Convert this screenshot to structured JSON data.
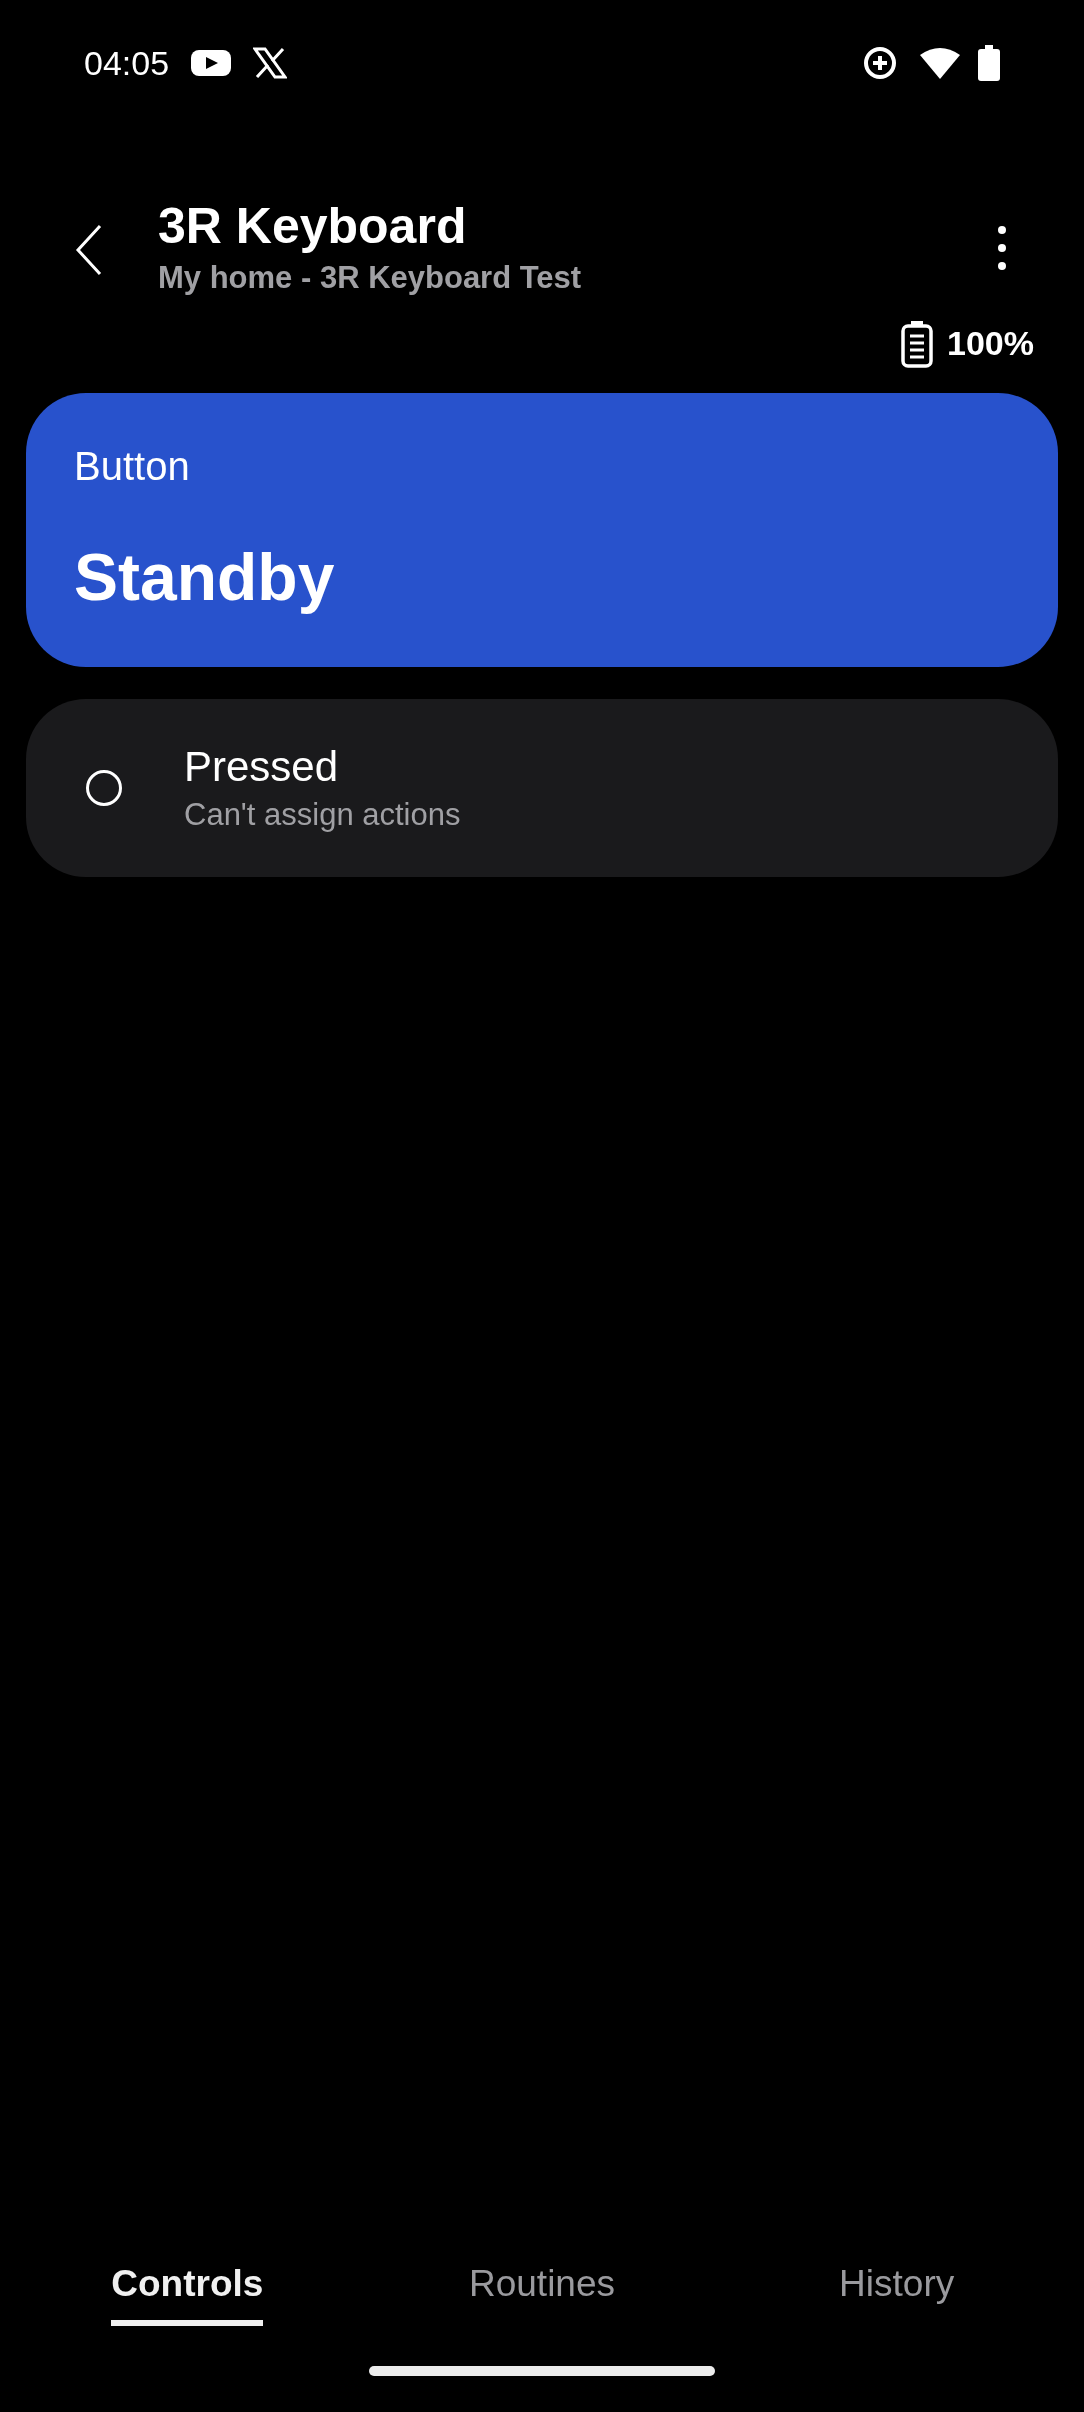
{
  "status_bar": {
    "time": "04:05"
  },
  "header": {
    "title": "3R Keyboard",
    "subtitle": "My home - 3R Keyboard Test"
  },
  "battery": {
    "reading": "100%"
  },
  "status_card": {
    "label": "Button",
    "value": "Standby"
  },
  "options": [
    {
      "title": "Pressed",
      "subtitle": "Can't assign actions",
      "selected": false
    }
  ],
  "tabs": [
    {
      "label": "Controls",
      "selected": true
    },
    {
      "label": "Routines",
      "selected": false
    },
    {
      "label": "History",
      "selected": false
    }
  ]
}
